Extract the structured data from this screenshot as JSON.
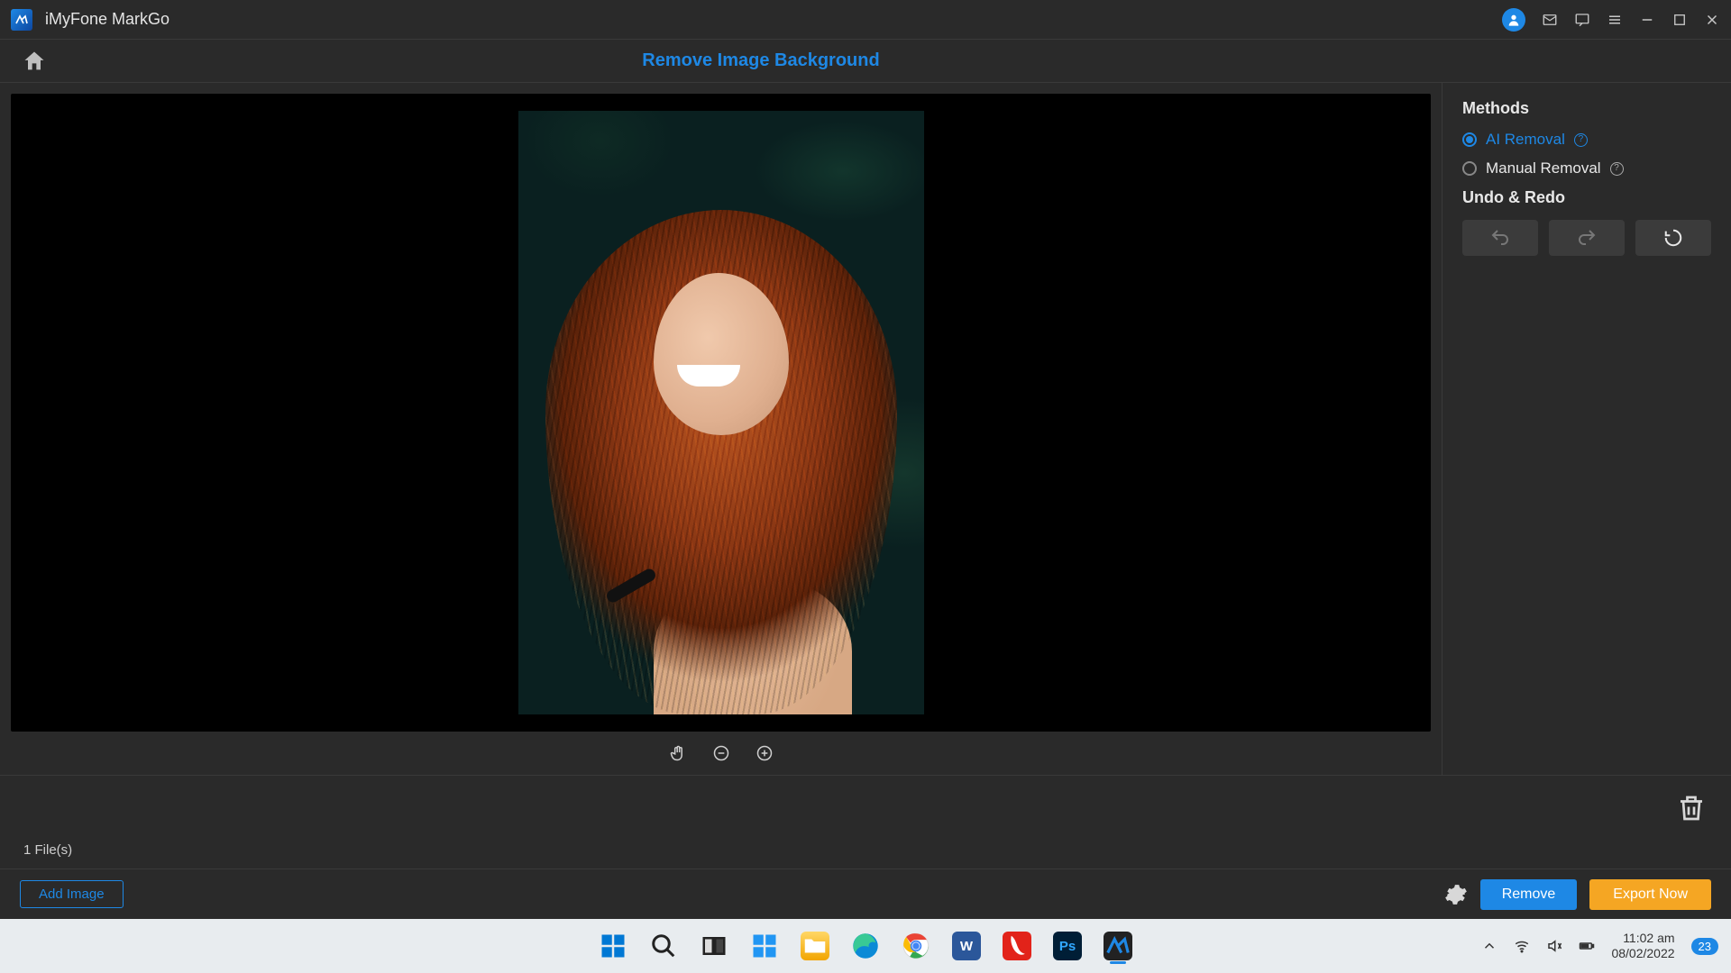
{
  "titlebar": {
    "app_name": "iMyFone MarkGo"
  },
  "header": {
    "page_title": "Remove Image Background"
  },
  "sidebar": {
    "methods_heading": "Methods",
    "methods": {
      "ai": "AI Removal",
      "manual": "Manual Removal",
      "selected": "ai"
    },
    "undo_heading": "Undo & Redo"
  },
  "bottom": {
    "file_count": "1 File(s)",
    "add_image": "Add Image",
    "remove": "Remove",
    "export": "Export Now"
  },
  "taskbar": {
    "clock_time": "11:02 am",
    "clock_date": "08/02/2022",
    "notif_count": "23"
  }
}
